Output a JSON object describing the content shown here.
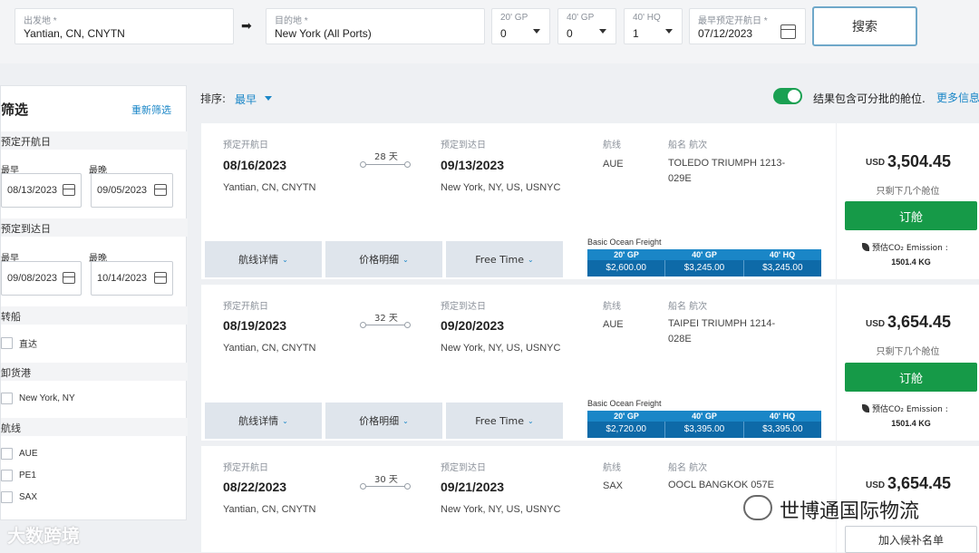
{
  "search": {
    "origin": {
      "label": "出发地 *",
      "value": "Yantian, CN, CNYTN"
    },
    "destination": {
      "label": "目的地 *",
      "value": "New York (All Ports)"
    },
    "gp20": {
      "label": "20' GP",
      "value": "0"
    },
    "gp40": {
      "label": "40' GP",
      "value": "0"
    },
    "hq40": {
      "label": "40' HQ",
      "value": "1"
    },
    "departure": {
      "label": "最早预定开航日 *",
      "value": "07/12/2023"
    },
    "search_button": "搜索"
  },
  "filters": {
    "title": "筛选",
    "reset": "重新筛选",
    "departure_section": "预定开航日",
    "arrival_section": "预定到达日",
    "earliest": "最早",
    "latest": "最晚",
    "dep_earliest": "08/13/2023",
    "dep_latest": "09/05/2023",
    "arr_earliest": "09/08/2023",
    "arr_latest": "10/14/2023",
    "transship_section": "转船",
    "direct": "直达",
    "unload_section": "卸货港",
    "unload_port": "New York, NY",
    "route_section": "航线",
    "routes": [
      "AUE",
      "PE1",
      "SAX"
    ]
  },
  "toolbar": {
    "sort_label": "排序:",
    "sort_value": "最早",
    "toggle_label": "结果包含可分批的舱位.",
    "more_info": "更多信息"
  },
  "labels": {
    "dep": "预定开航日",
    "arr": "预定到达日",
    "route": "航线",
    "vessel": "船名 航次",
    "route_details": "航线详情",
    "price_details": "价格明细",
    "free_time": "Free Time",
    "bof_title": "Basic Ocean Freight",
    "bof_cols": [
      "20' GP",
      "40' GP",
      "40' HQ"
    ],
    "currency": "USD",
    "book": "订舱",
    "co2_label": "预估CO₂ Emission :",
    "waitlist": "加入候补名单"
  },
  "results": [
    {
      "dep_date": "08/16/2023",
      "origin": "Yantian, CN, CNYTN",
      "days": "28 天",
      "arr_date": "09/13/2023",
      "destination": "New York, NY, US, USNYC",
      "route": "AUE",
      "vessel": "TOLEDO TRIUMPH  1213-029E",
      "bof": [
        "$2,600.00",
        "$3,245.00",
        "$3,245.00"
      ],
      "price": "3,504.45",
      "note": "只剩下几个舱位",
      "co2": "1501.4 KG"
    },
    {
      "dep_date": "08/19/2023",
      "origin": "Yantian, CN, CNYTN",
      "days": "32 天",
      "arr_date": "09/20/2023",
      "destination": "New York, NY, US, USNYC",
      "route": "AUE",
      "vessel": "TAIPEI TRIUMPH  1214-028E",
      "bof": [
        "$2,720.00",
        "$3,395.00",
        "$3,395.00"
      ],
      "price": "3,654.45",
      "note": "只剩下几个舱位",
      "co2": "1501.4 KG"
    },
    {
      "dep_date": "08/22/2023",
      "origin": "Yantian, CN, CNYTN",
      "days": "30 天",
      "arr_date": "09/21/2023",
      "destination": "New York, NY, US, USNYC",
      "route": "SAX",
      "vessel": "OOCL BANGKOK  057E",
      "price": "3,654.45"
    }
  ],
  "watermarks": {
    "left": "大数跨境",
    "right": "世博通国际物流"
  }
}
